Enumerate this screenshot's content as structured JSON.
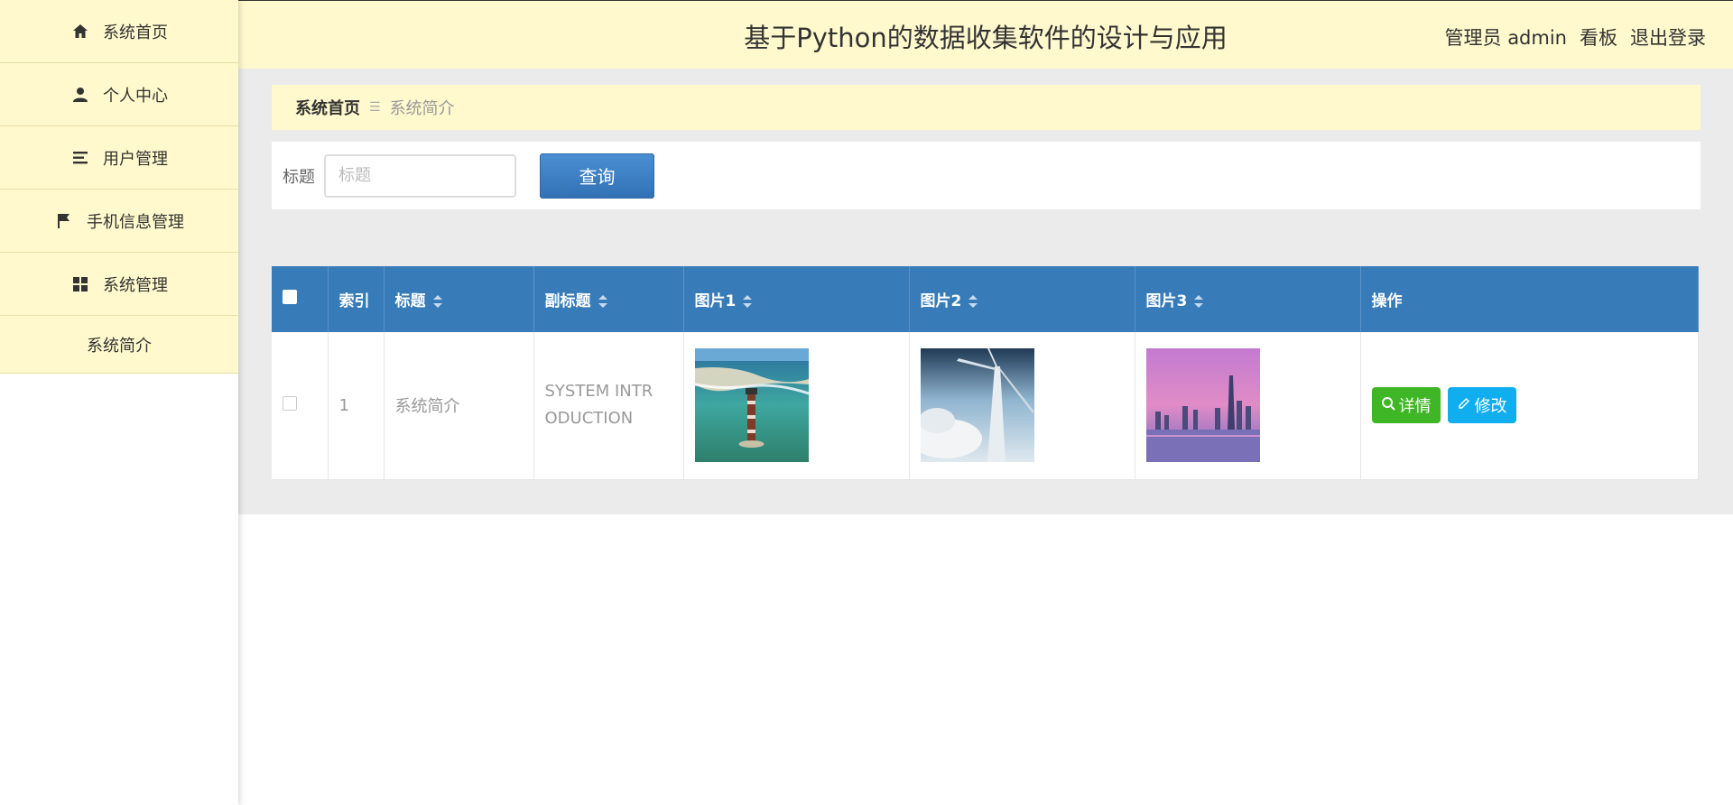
{
  "sidebar": {
    "items": [
      {
        "label": "系统首页",
        "icon": "home-icon"
      },
      {
        "label": "个人中心",
        "icon": "user-icon"
      },
      {
        "label": "用户管理",
        "icon": "list-icon"
      },
      {
        "label": "手机信息管理",
        "icon": "flag-icon"
      },
      {
        "label": "系统管理",
        "icon": "grid-icon"
      }
    ],
    "sub_item": "系统简介"
  },
  "header": {
    "title": "基于Python的数据收集软件的设计与应用",
    "user": "管理员 admin",
    "board": "看板",
    "logout": "退出登录"
  },
  "breadcrumb": {
    "home": "系统首页",
    "current": "系统简介"
  },
  "search": {
    "label": "标题",
    "placeholder": "标题",
    "button": "查询"
  },
  "table": {
    "headers": [
      "索引",
      "标题",
      "副标题",
      "图片1",
      "图片2",
      "图片3",
      "操作"
    ],
    "rows": [
      {
        "index": "1",
        "title": "系统简介",
        "subtitle": "SYSTEM INTRODUCTION",
        "image1": "lighthouse photo",
        "image2": "wind turbine photo",
        "image3": "city skyline photo"
      }
    ],
    "detail_button": "详情",
    "edit_button": "修改"
  },
  "colors": {
    "header_bg": "#fff9cd",
    "table_header": "#377bb9",
    "search_button": "#3f80c4",
    "detail_button": "#3fb625",
    "edit_button": "#10aeef"
  }
}
